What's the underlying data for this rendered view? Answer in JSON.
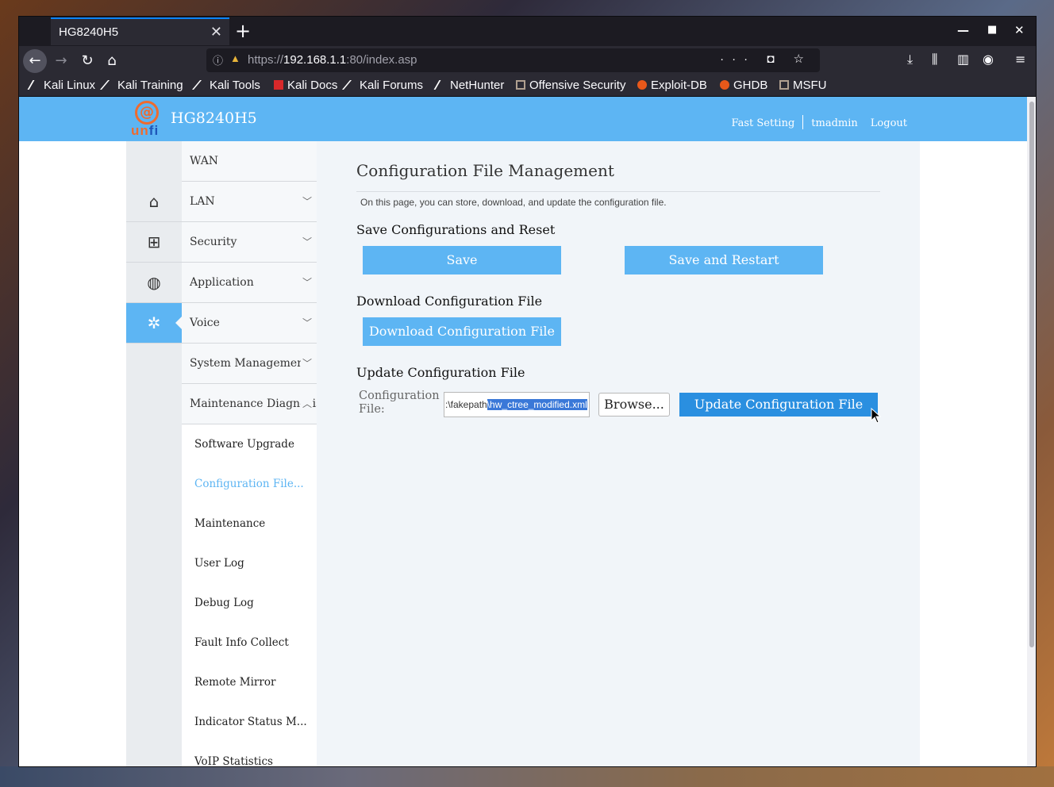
{
  "browser": {
    "tab_title": "HG8240H5",
    "url_prefix": "https://",
    "url_host": "192.168.1.1",
    "url_rest": ":80/index.asp",
    "bookmarks": [
      "Kali Linux",
      "Kali Training",
      "Kali Tools",
      "Kali Docs",
      "Kali Forums",
      "NetHunter",
      "Offensive Security",
      "Exploit-DB",
      "GHDB",
      "MSFU"
    ]
  },
  "header": {
    "logo_text_a": "un",
    "logo_text_b": "fi",
    "model": "HG8240H5",
    "fast_setting": "Fast Setting",
    "user": "tmadmin",
    "logout": "Logout"
  },
  "menu": {
    "items": [
      "WAN",
      "LAN",
      "Security",
      "Application",
      "Voice",
      "System Management",
      "Maintenance Diagnosis"
    ],
    "subitems": [
      "Software Upgrade",
      "Configuration File...",
      "Maintenance",
      "User Log",
      "Debug Log",
      "Fault Info Collect",
      "Remote Mirror",
      "Indicator Status M...",
      "VoIP Statistics"
    ]
  },
  "content": {
    "title": "Configuration File Management",
    "description": "On this page, you can store, download, and update the configuration file.",
    "save_section": "Save Configurations and Reset",
    "save_button": "Save",
    "save_restart_button": "Save and Restart",
    "download_section": "Download Configuration File",
    "download_button": "Download Configuration File",
    "update_section": "Update Configuration File",
    "file_label": "Configuration File:",
    "file_path_prefix": ":\\fakepath",
    "file_path_selected": "\\hw_ctree_modified.xml",
    "browse_button": "Browse...",
    "update_button": "Update Configuration File"
  },
  "colors": {
    "accent": "#5db5f3",
    "update_button": "#2a8fe0",
    "logo_orange": "#ef6b2e",
    "logo_blue": "#1f56b8"
  }
}
